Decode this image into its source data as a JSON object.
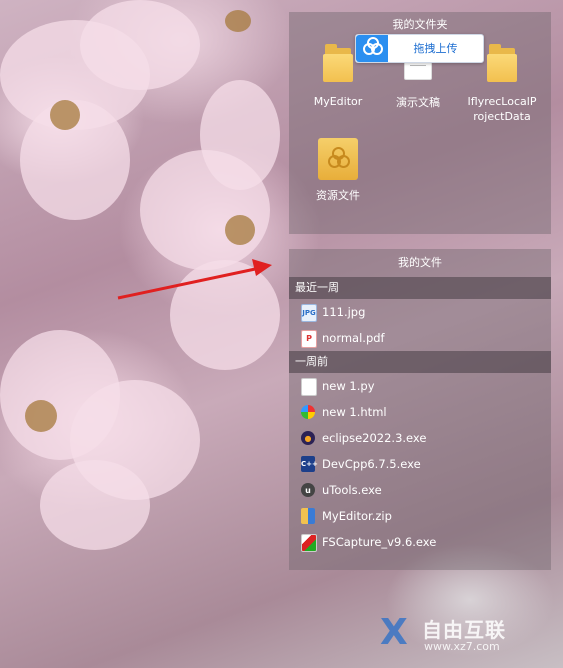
{
  "desktop_folder_panel": {
    "title": "我的文件夹",
    "items": [
      {
        "label": "MyEditor",
        "icon": "folder-icon"
      },
      {
        "label": "演示文稿",
        "icon": "document-folder-icon"
      },
      {
        "label": "IflyrecLocalProjectData",
        "line1": "IflyrecLocalP",
        "line2": "rojectData",
        "icon": "folder-icon"
      },
      {
        "label": "资源文件",
        "icon": "resource-folder-icon"
      }
    ]
  },
  "upload_bar": {
    "label": "拖拽上传",
    "icon": "cloud-upload-icon",
    "color": "#2b8ff0"
  },
  "file_panel": {
    "title": "我的文件",
    "sections": [
      {
        "header": "最近一周",
        "files": [
          {
            "name": "111.jpg",
            "icon": "jpg-file-icon"
          },
          {
            "name": "normal.pdf",
            "icon": "pdf-file-icon"
          }
        ]
      },
      {
        "header": "一周前",
        "files": [
          {
            "name": "new 1.py",
            "icon": "blank-file-icon"
          },
          {
            "name": "new 1.html",
            "icon": "html-file-icon"
          },
          {
            "name": "eclipse2022.3.exe",
            "icon": "eclipse-icon"
          },
          {
            "name": "DevCpp6.7.5.exe",
            "icon": "devcpp-icon"
          },
          {
            "name": "uTools.exe",
            "icon": "utools-icon"
          },
          {
            "name": "MyEditor.zip",
            "icon": "zip-file-icon"
          },
          {
            "name": "FSCapture_v9.6.exe",
            "icon": "fscapture-icon"
          }
        ]
      }
    ]
  },
  "watermark": {
    "brand": "自由互联",
    "url": "www.xz7.com"
  },
  "annotation_arrow_color": "#e02020"
}
